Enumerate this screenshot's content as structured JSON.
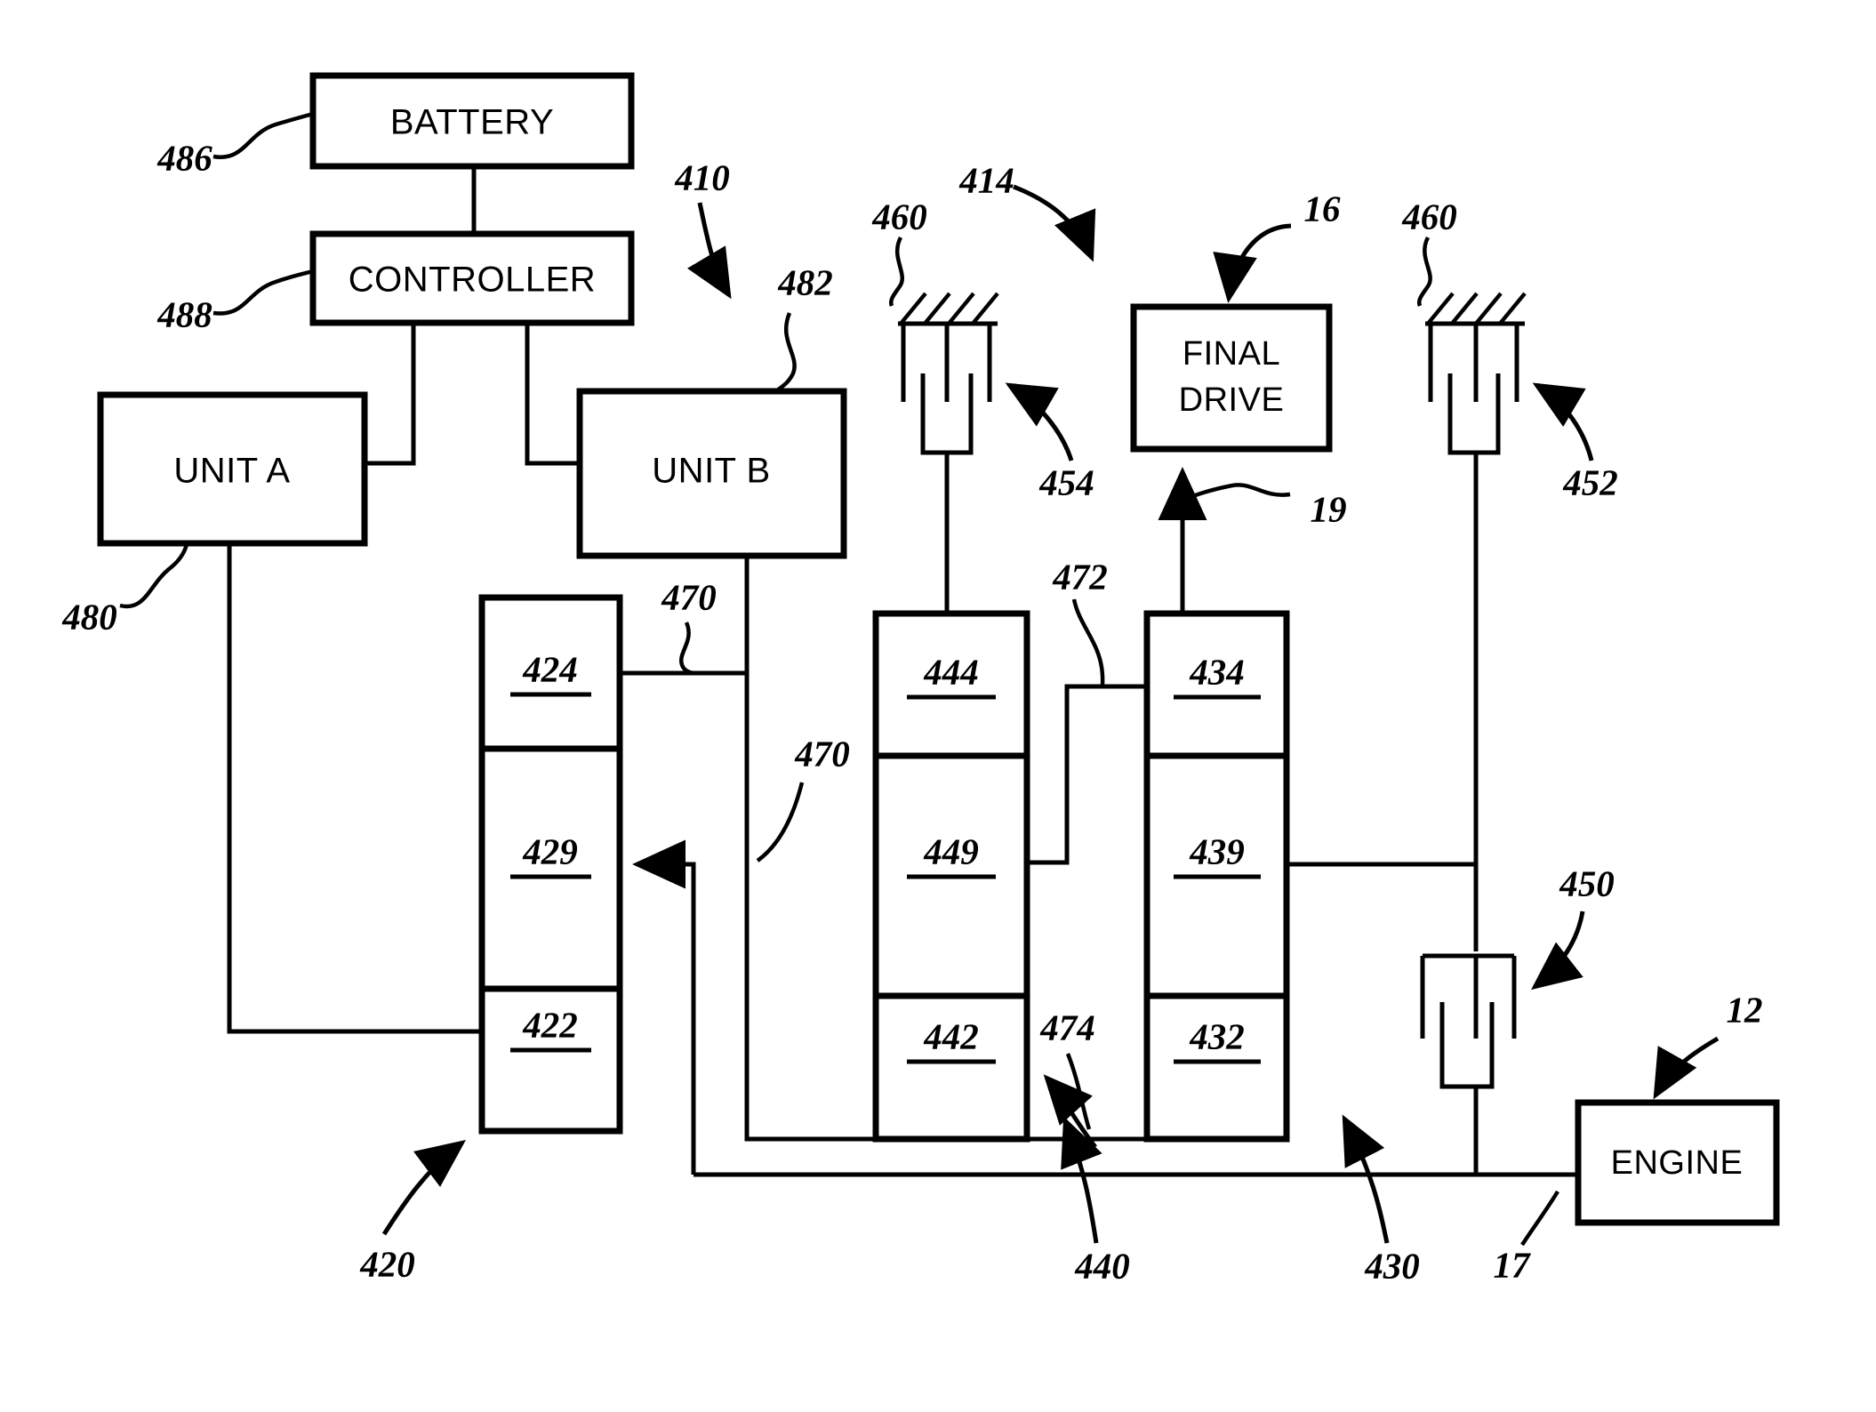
{
  "figure": {
    "type": "patent-schematic",
    "title": "Hybrid powertrain block schematic",
    "background": "#ffffff",
    "line_color": "#000000"
  },
  "boxes": {
    "battery": {
      "label": "BATTERY"
    },
    "controller": {
      "label": "CONTROLLER"
    },
    "unit_a": {
      "label": "UNIT A"
    },
    "unit_b": {
      "label": "UNIT B"
    },
    "final_drive": {
      "label_line1": "FINAL",
      "label_line2": "DRIVE"
    },
    "engine": {
      "label": "ENGINE"
    }
  },
  "node_numbers": {
    "col420": [
      "424",
      "429",
      "422"
    ],
    "col440": [
      "444",
      "449",
      "442"
    ],
    "col430": [
      "434",
      "439",
      "432"
    ]
  },
  "reference_numerals": {
    "n486": "486",
    "n488": "488",
    "n480": "480",
    "n482": "482",
    "n410": "410",
    "n414": "414",
    "n460_left": "460",
    "n460_right": "460",
    "n454": "454",
    "n452": "452",
    "n450": "450",
    "n16": "16",
    "n19": "19",
    "n12": "12",
    "n17": "17",
    "n470_upper": "470",
    "n470_lower": "470",
    "n472": "472",
    "n474": "474",
    "n420": "420",
    "n430": "430",
    "n440": "440"
  },
  "icons": {
    "ground_left": "ground-hatch-icon",
    "ground_right": "ground-hatch-icon",
    "brake_left": "brake-bracket-icon",
    "brake_right": "brake-bracket-icon",
    "clutch": "clutch-bracket-icon",
    "arrow_to_final_drive": "arrow-up-icon",
    "arrow_to_node429": "arrow-left-icon"
  }
}
